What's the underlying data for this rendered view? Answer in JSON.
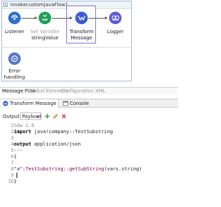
{
  "flow": {
    "title": "invokecustomjavaFlow1",
    "nodes": [
      {
        "label": "Listener"
      },
      {
        "label_top": "Set Variable",
        "label_bottom": "stringValue",
        "badge": "var"
      },
      {
        "label_top": "Transform",
        "label_bottom": "Message"
      },
      {
        "label": "Logger"
      }
    ],
    "error_handling": {
      "label_top": "Error",
      "label_bottom": "handling"
    }
  },
  "editor_tabs": {
    "message_flow": "Message Flow",
    "global_elements": "Global Elements",
    "configuration_xml": "Configuration XML"
  },
  "panel": {
    "transform_tab": "Transform Message",
    "console_tab": "Console",
    "output_label": "Output",
    "output_value": "Payload"
  },
  "code": {
    "line_numbers": [
      "1",
      "2",
      "3",
      "4",
      "5",
      "6",
      "7",
      "8",
      "9",
      "10"
    ],
    "l1": "%dw 2.0",
    "l2_kw": "import",
    "l2_rest": " java!company::TestSubstring",
    "l4_kw": "output",
    "l4_rest": " application/json",
    "l5": "---",
    "l6": "{",
    "l8_key": "\"a\"",
    "l8_colon": ":",
    "l8_fn": "TestSubstring::getSubString",
    "l8_arg": "(vars.string)",
    "l10": "}"
  },
  "colors": {
    "listener": "#2c6fd1",
    "set_variable": "#1f9e58",
    "transform": "#3b5bd6",
    "logger": "#5a5ad8",
    "error_handling": "#5878c8"
  }
}
